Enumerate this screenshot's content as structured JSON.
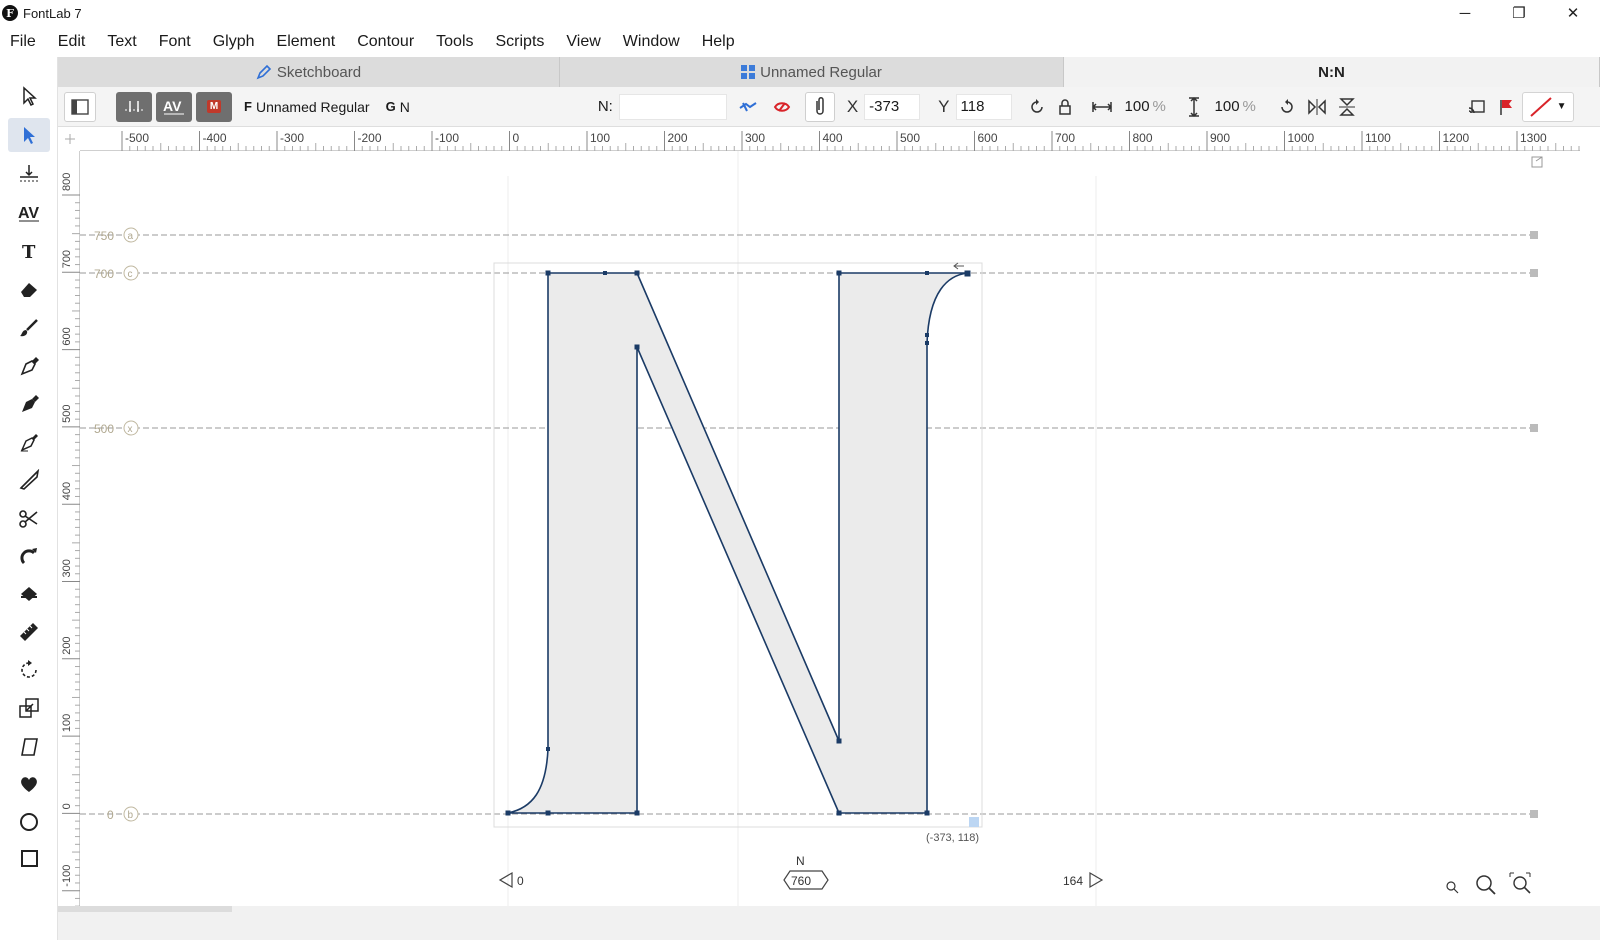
{
  "window": {
    "logo": "F",
    "title": "FontLab 7",
    "minimize": "─",
    "restore": "❐",
    "close": "✕"
  },
  "menu": [
    "File",
    "Edit",
    "Text",
    "Font",
    "Glyph",
    "Element",
    "Contour",
    "Tools",
    "Scripts",
    "View",
    "Window",
    "Help"
  ],
  "tools": [
    "pointer-icon",
    "contour-select-icon",
    "guide-icon",
    "metrics-icon",
    "text-icon",
    "eraser-icon",
    "brush-icon",
    "pen-icon",
    "rapidograph-icon",
    "pencil-icon",
    "knife-icon",
    "scissors-icon",
    "magnet-icon",
    "fill-icon",
    "ruler-icon",
    "rotate-icon",
    "scale-icon",
    "slant-icon",
    "heart-icon",
    "ellipse-icon",
    "rectangle-icon"
  ],
  "tabs": [
    {
      "label": "Sketchboard",
      "icon": "pen-icon"
    },
    {
      "label": "Unnamed Regular",
      "icon": "grid-icon"
    },
    {
      "label": "N:N",
      "icon": ""
    }
  ],
  "propbar": {
    "font_prefix": "F",
    "font_name": "Unnamed Regular",
    "glyph_prefix": "G",
    "glyph_name": "N",
    "name_label": "N:",
    "name_value": "",
    "x_label": "X",
    "x_value": "-373",
    "y_label": "Y",
    "y_value": "118",
    "width_scale": "100",
    "height_scale": "100",
    "percent": "%",
    "mode_badge": "M"
  },
  "ruler": {
    "h_labels": [
      "-500",
      "-400",
      "-300",
      "-200",
      "-100",
      "0",
      "100",
      "200",
      "300",
      "400",
      "500",
      "600",
      "700",
      "800",
      "900",
      "1000",
      "1100",
      "1200",
      "1300"
    ],
    "v_labels": [
      "800",
      "700",
      "600",
      "500",
      "400",
      "300",
      "200",
      "100",
      "0",
      "-100"
    ]
  },
  "metrics": [
    {
      "value": "750",
      "tag": "a"
    },
    {
      "value": "700",
      "tag": "c"
    },
    {
      "value": "500",
      "tag": "x"
    },
    {
      "value": "0",
      "tag": "b"
    }
  ],
  "glyph": {
    "name": "N",
    "advance_width": "760",
    "lsb": "0",
    "rsb": "164",
    "cursor_readout": "(-373, 118)"
  },
  "colors": {
    "contour": "#1b3b66",
    "fill": "#ebebeb",
    "metric_line": "#9a9a9a",
    "metric_label": "#b0a890",
    "accent": "#2f6fd6",
    "red": "#d9242a"
  }
}
